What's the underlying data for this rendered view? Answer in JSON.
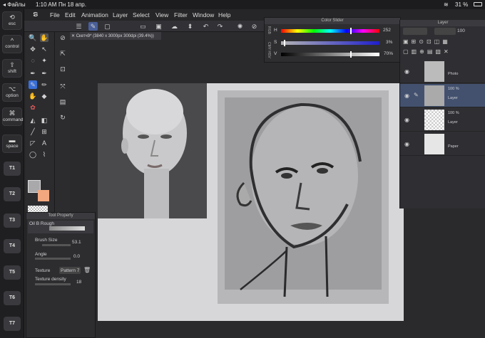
{
  "status": {
    "carrier": "◂ Файлы",
    "time": "1:10 AM",
    "date": "Пн 18 апр.",
    "battery": "31 %"
  },
  "menu": {
    "items": [
      "File",
      "Edit",
      "Animation",
      "Layer",
      "Select",
      "View",
      "Filter",
      "Window",
      "Help"
    ]
  },
  "keys": {
    "esc": "esc",
    "control": "control",
    "shift": "shift",
    "option": "option",
    "command": "command",
    "space": "space",
    "tkeys": [
      "T1",
      "T2",
      "T3",
      "T4",
      "T5",
      "T6",
      "T7"
    ]
  },
  "document": {
    "tab_title": "Скетч9* (3840 x 3000px 300dpi (39.4%))"
  },
  "color_slider": {
    "title": "Color Slider",
    "mode_rgb": "RGB",
    "mode_hsv": "CMY HSV",
    "h_label": "H",
    "s_label": "S",
    "v_label": "V",
    "h_value": "252",
    "s_value": "3%",
    "v_value": "70%",
    "h_fraction": 0.7,
    "s_fraction": 0.03,
    "v_fraction": 0.7
  },
  "layer_panel": {
    "title": "Layer",
    "opacity": "100",
    "layers": [
      {
        "name": "Photo",
        "opacity": ""
      },
      {
        "name": "Layer",
        "opacity": "100 %"
      },
      {
        "name": "Layer",
        "opacity": "100 %"
      },
      {
        "name": "Paper",
        "opacity": ""
      }
    ]
  },
  "tool_property": {
    "title": "Tool Property",
    "brush_name": "Oil B Rough",
    "brush_size_label": "Brush Size",
    "brush_size_value": "53.1",
    "angle_label": "Angle",
    "angle_value": "0.0",
    "texture_label": "Texture",
    "texture_value": "Pattern 7",
    "density_label": "Texture density",
    "density_value": "18"
  },
  "colors": {
    "main": "#a9a9ac",
    "sub": "#f2a77e",
    "accent": "#3a6fd8",
    "panel": "#2e2e31"
  }
}
